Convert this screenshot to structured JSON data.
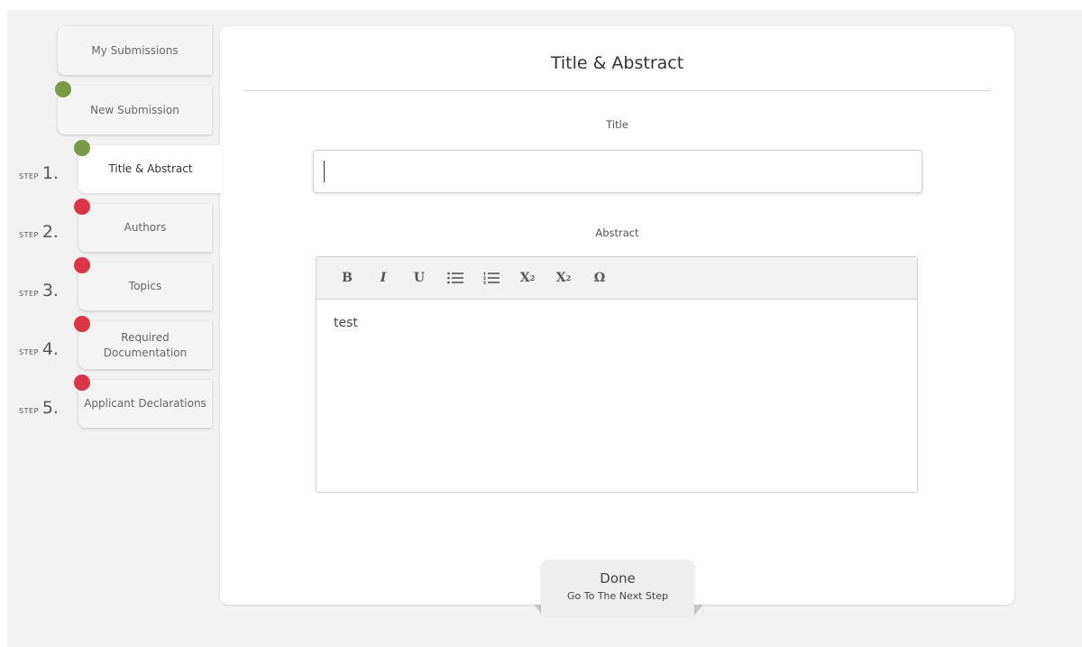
{
  "sidebar": {
    "my_submissions": "My Submissions",
    "new_submission": "New Submission",
    "step_word": "STEP",
    "steps": [
      {
        "num": "1.",
        "label": "Title & Abstract",
        "status_color": "#7a9a45"
      },
      {
        "num": "2.",
        "label": "Authors",
        "status_color": "#dc3545"
      },
      {
        "num": "3.",
        "label": "Topics",
        "status_color": "#dc3545"
      },
      {
        "num": "4.",
        "label": "Required Documentation",
        "status_color": "#dc3545"
      },
      {
        "num": "5.",
        "label": "Applicant Declarations",
        "status_color": "#dc3545"
      }
    ],
    "new_submission_status_color": "#7a9a45"
  },
  "main": {
    "title": "Title & Abstract",
    "title_field_label": "Title",
    "title_value": "",
    "abstract_label": "Abstract",
    "abstract_value": "test",
    "toolbar": {
      "bold": "B",
      "italic": "I",
      "underline": "U",
      "bullet_list_icon": "☰",
      "numbered_list_icon": "☰",
      "superscript": "X",
      "superscript_mark": "2",
      "subscript": "X",
      "subscript_mark": "2",
      "special_char": "Ω"
    },
    "done_label": "Done",
    "done_sub": "Go To The Next Step"
  }
}
